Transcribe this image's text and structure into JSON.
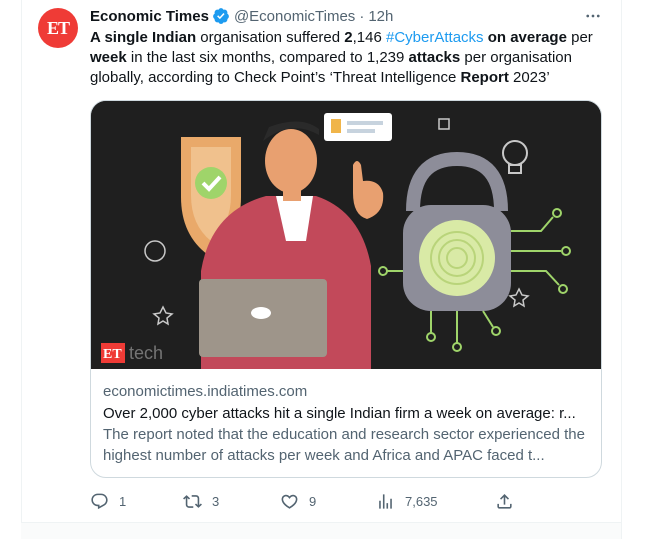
{
  "tweet": {
    "avatar_text": "ET",
    "author": "Economic Times",
    "handle": "@EconomicTimes",
    "separator": "·",
    "time": "12h",
    "more_icon": "more-icon",
    "text_parts": [
      {
        "t": "A single Indian",
        "s": "b"
      },
      {
        "t": " organisation suffered ",
        "s": ""
      },
      {
        "t": "2",
        "s": "b"
      },
      {
        "t": ",146 ",
        "s": ""
      },
      {
        "t": "#CyberAttacks",
        "s": "h"
      },
      {
        "t": " ",
        "s": ""
      },
      {
        "t": "on average",
        "s": "b"
      },
      {
        "t": " per ",
        "s": ""
      },
      {
        "t": "week",
        "s": "b"
      },
      {
        "t": " in the last six months, compared to 1,239 ",
        "s": ""
      },
      {
        "t": "attacks",
        "s": "b"
      },
      {
        "t": " per organisation globally, according to Check Point’s ‘Threat Intelligence ",
        "s": ""
      },
      {
        "t": "Report",
        "s": "b"
      },
      {
        "t": " 2023’",
        "s": ""
      }
    ]
  },
  "card": {
    "image_watermark": "ET tech",
    "domain": "economictimes.indiatimes.com",
    "title": "Over 2,000 cyber attacks hit a single Indian firm a week on average: r...",
    "description": "The report noted that the education and research sector experienced the highest number of attacks per week and Africa and APAC faced t..."
  },
  "actions": {
    "reply_count": "1",
    "retweet_count": "3",
    "like_count": "9",
    "views_count": "7,635"
  },
  "colors": {
    "accent": "#1d9bf0",
    "text_primary": "#0f1419",
    "text_secondary": "#536471",
    "avatar_bg": "#ef3b36"
  }
}
